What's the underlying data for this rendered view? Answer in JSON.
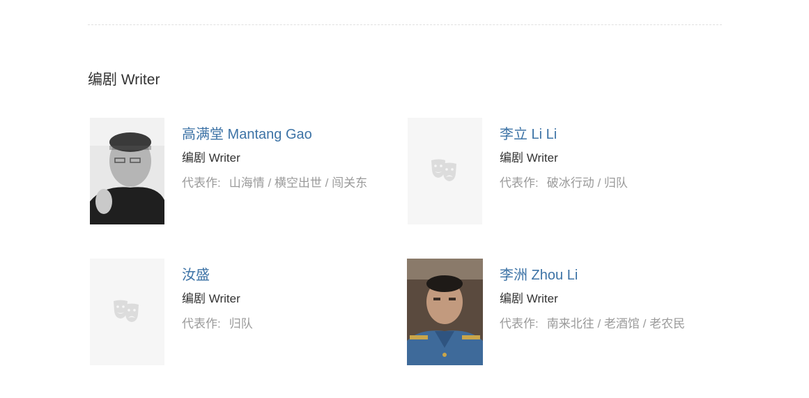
{
  "section": {
    "title": "编剧 Writer"
  },
  "cards": [
    {
      "name": "高满堂 Mantang Gao",
      "role": "编剧 Writer",
      "works_label": "代表作:",
      "works": "山海情 / 横空出世 / 闯关东",
      "photo": "portrait-photo"
    },
    {
      "name": "李立 Li Li",
      "role": "编剧 Writer",
      "works_label": "代表作:",
      "works": "破冰行动 / 归队",
      "photo": "placeholder-mask-icon"
    },
    {
      "name": "汝盛",
      "role": "编剧 Writer",
      "works_label": "代表作:",
      "works": "归队",
      "photo": "placeholder-mask-icon"
    },
    {
      "name": "李洲 Zhou Li",
      "role": "编剧 Writer",
      "works_label": "代表作:",
      "works": "南来北往 / 老酒馆 / 老农民",
      "photo": "portrait-photo"
    }
  ],
  "colors": {
    "link": "#3d73a6",
    "text": "#333333",
    "muted": "#9a9a9a",
    "placeholder_bg": "#f6f6f6",
    "divider": "#e0e0e0"
  }
}
